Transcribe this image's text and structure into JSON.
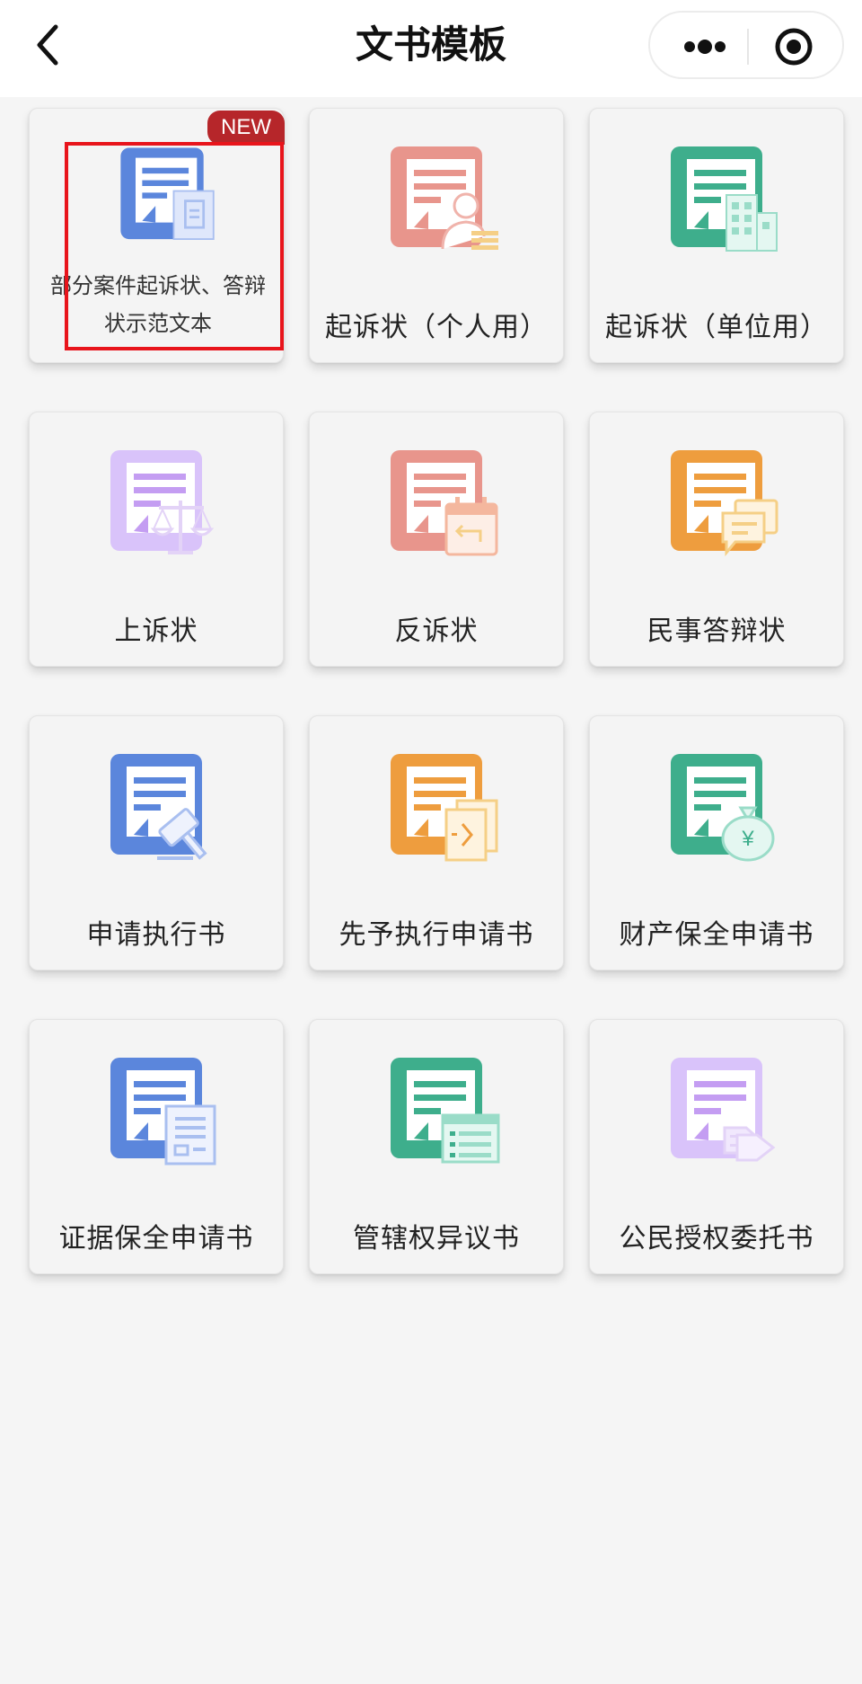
{
  "header": {
    "title": "文书模板",
    "back_icon": "chevron-left-icon",
    "more_icon": "more-dots-icon",
    "target_icon": "target-icon"
  },
  "colors": {
    "blue": "#5b86dc",
    "salmon": "#e8958c",
    "green": "#3eae8c",
    "purple": "#c49df2",
    "orange": "#ee9d3e",
    "badge": "#b6262a",
    "highlight": "#e8141b"
  },
  "templates": [
    {
      "label": "部分案件起诉状、答辩状示范文本",
      "icon": "document-with-file-icon",
      "badge": "NEW"
    },
    {
      "label": "起诉状（个人用）",
      "icon": "document-with-person-icon"
    },
    {
      "label": "起诉状（单位用）",
      "icon": "document-with-building-icon"
    },
    {
      "label": "上诉状",
      "icon": "document-with-scale-icon"
    },
    {
      "label": "反诉状",
      "icon": "document-with-calendar-return-icon"
    },
    {
      "label": "民事答辩状",
      "icon": "document-with-chat-icon"
    },
    {
      "label": "申请执行书",
      "icon": "document-with-gavel-icon"
    },
    {
      "label": "先予执行申请书",
      "icon": "document-with-forward-icon"
    },
    {
      "label": "财产保全申请书",
      "icon": "document-with-moneybag-icon"
    },
    {
      "label": "证据保全申请书",
      "icon": "document-with-paper-icon"
    },
    {
      "label": "管辖权异议书",
      "icon": "document-with-list-icon"
    },
    {
      "label": "公民授权委托书",
      "icon": "document-with-handshake-icon"
    }
  ]
}
